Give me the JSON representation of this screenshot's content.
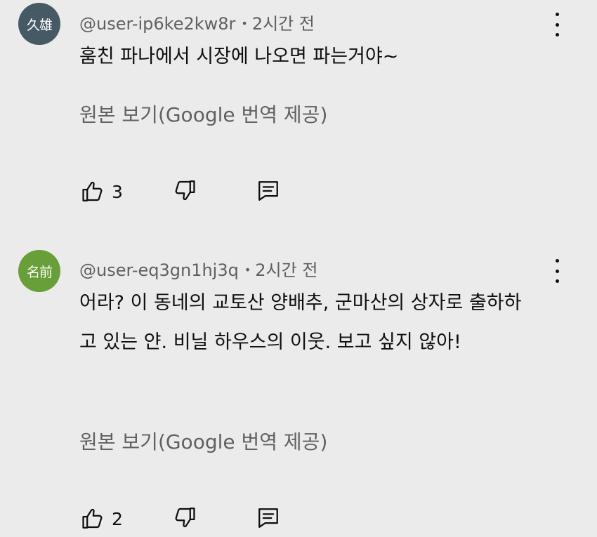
{
  "comments": [
    {
      "avatar_text": "久雄",
      "avatar_color": "#455a64",
      "username": "@user-ip6ke2kw8r",
      "time": "2시간 전",
      "text": "훔친 파나에서 시장에 나오면 파는거야~",
      "translate_label": "원본 보기(Google 번역 제공)",
      "like_count": "3",
      "icons": {
        "like": "thumbs-up-icon",
        "dislike": "thumbs-down-icon",
        "reply": "reply-icon",
        "more": "more-vert-icon"
      }
    },
    {
      "avatar_text": "名前",
      "avatar_color": "#689f38",
      "username": "@user-eq3gn1hj3q",
      "time": "2시간 전",
      "text": "어라? 이 동네의 교토산 양배추, 군마산의 상자로 출하하고 있는 얀. 비닐 하우스의 이웃. 보고 싶지 않아!",
      "translate_label": "원본 보기(Google 번역 제공)",
      "like_count": "2",
      "icons": {
        "like": "thumbs-up-icon",
        "dislike": "thumbs-down-icon",
        "reply": "reply-icon",
        "more": "more-vert-icon"
      }
    }
  ]
}
